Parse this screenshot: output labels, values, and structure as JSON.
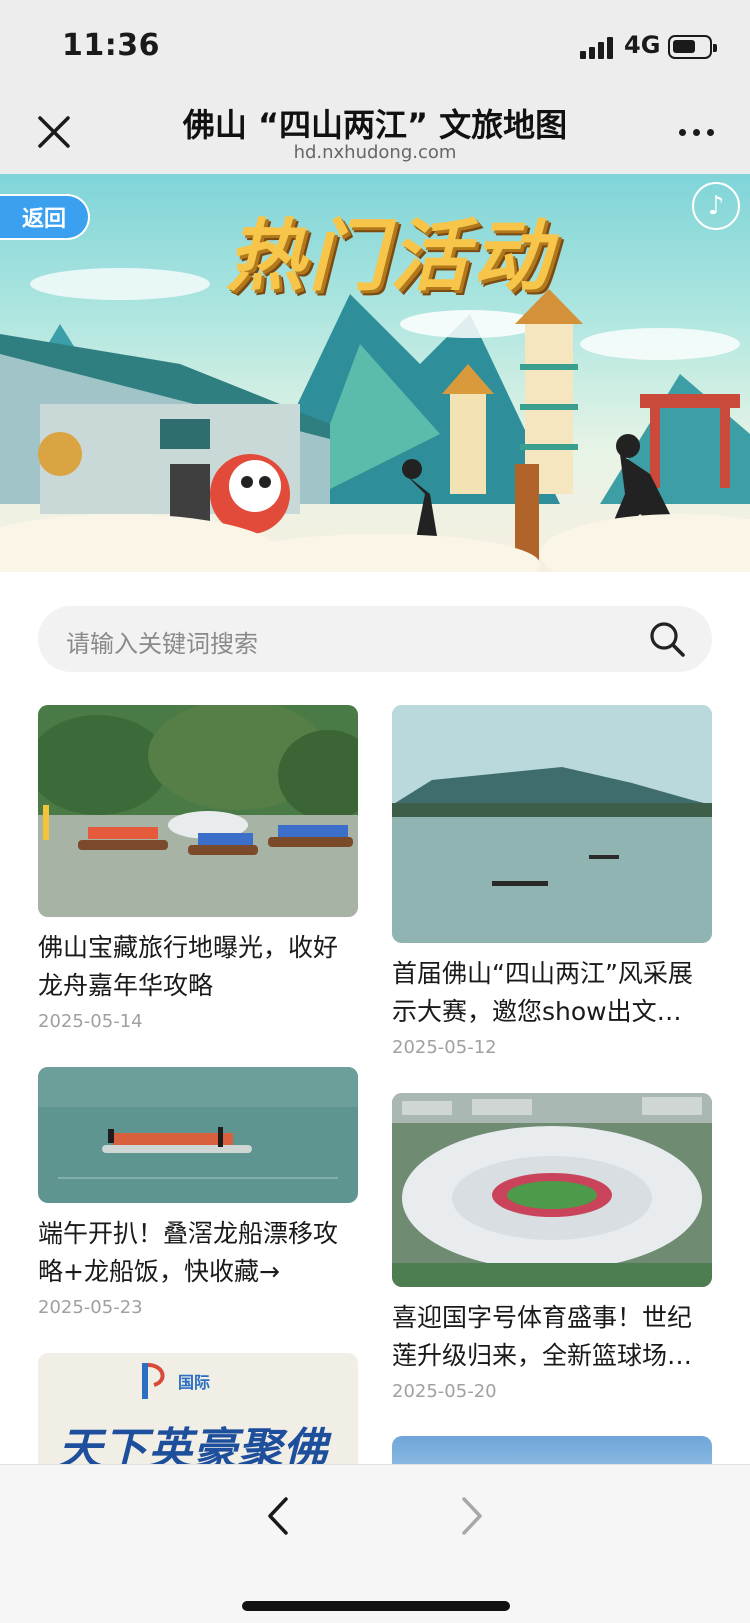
{
  "status_bar": {
    "time": "11:36",
    "network": "4G"
  },
  "nav": {
    "title": "佛山 “四山两江” 文旅地图",
    "domain": "hd.nxhudong.com"
  },
  "banner": {
    "back_label": "返回",
    "title": "热门活动"
  },
  "search": {
    "placeholder": "请输入关键词搜索"
  },
  "cards": [
    {
      "title": "佛山宝藏旅行地曝光，收好龙舟嘉年华攻略",
      "date": "2025-05-14"
    },
    {
      "title": "首届佛山“四山两江”风采展示大赛，邀您show出文…",
      "date": "2025-05-12"
    },
    {
      "title": "端午开扒！叠滘龙船漂移攻略+龙船饭，快收藏→",
      "date": "2025-05-23"
    },
    {
      "title": "喜迎国字号体育盛事！世纪莲升级归来，全新篮球场…",
      "date": "2025-05-20"
    },
    {
      "title": "",
      "date": ""
    },
    {
      "title": "",
      "date": ""
    }
  ],
  "poster_text": {
    "event_line": "国际",
    "headline": "天下英豪聚佛山"
  }
}
